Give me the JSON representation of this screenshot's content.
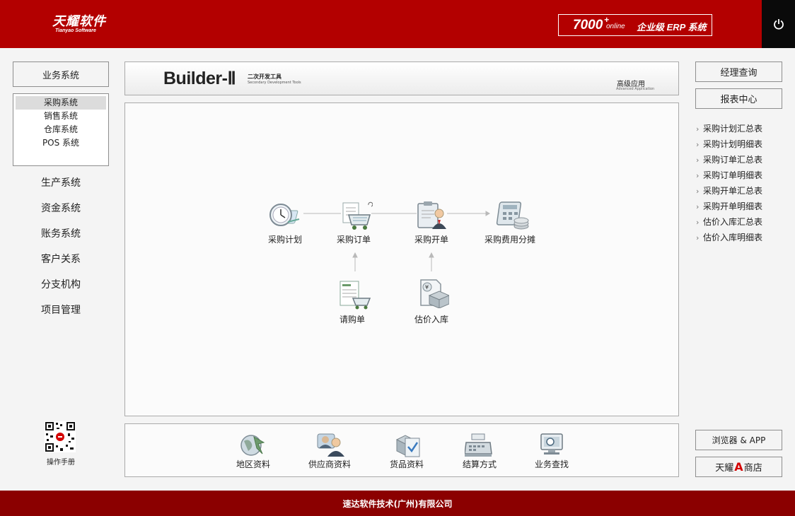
{
  "header": {
    "logo_main": "天耀软件",
    "logo_sub": "Tianyao Software",
    "product_number": "7000",
    "product_plus": "+",
    "product_online": "online",
    "product_tagline": "企业级 ERP 系统",
    "power_icon": "power-icon"
  },
  "left_nav": {
    "business_button": "业务系统",
    "sub_items": [
      "采购系统",
      "销售系统",
      "仓库系统",
      "POS 系统"
    ],
    "main_items": [
      "生产系统",
      "资金系统",
      "账务系统",
      "客户关系",
      "分支机构",
      "项目管理"
    ],
    "manual_label": "操作手册"
  },
  "builder": {
    "title": "Builder-Ⅱ",
    "subtitle_zh": "二次开发工具",
    "subtitle_en": "Secondary Development Tools",
    "advanced_zh": "高级应用",
    "advanced_en": "Advanced Application"
  },
  "flow": {
    "nodes": [
      {
        "label": "采购计划",
        "icon": "clock-document-icon"
      },
      {
        "label": "采购订单",
        "icon": "shopping-cart-icon"
      },
      {
        "label": "采购开单",
        "icon": "clipboard-person-icon"
      },
      {
        "label": "采购费用分摊",
        "icon": "calculator-coins-icon"
      },
      {
        "label": "请购单",
        "icon": "request-form-icon"
      },
      {
        "label": "估价入库",
        "icon": "yen-box-icon"
      }
    ]
  },
  "tools": [
    {
      "label": "地区资料",
      "icon": "globe-arrow-icon"
    },
    {
      "label": "供应商资料",
      "icon": "suppliers-icon"
    },
    {
      "label": "货品资料",
      "icon": "goods-checklist-icon"
    },
    {
      "label": "结算方式",
      "icon": "cash-register-icon"
    },
    {
      "label": "业务查找",
      "icon": "monitor-search-icon"
    }
  ],
  "right_panel": {
    "manager_query": "经理查询",
    "report_center": "报表中心",
    "reports": [
      "采购计划汇总表",
      "采购计划明细表",
      "采购订单汇总表",
      "采购订单明细表",
      "采购开单汇总表",
      "采购开单明细表",
      "估价入库汇总表",
      "估价入库明细表"
    ],
    "browser_app": "浏览器 & APP",
    "store_pre": "天耀",
    "store_letter": "A",
    "store_post": "商店"
  },
  "footer": {
    "company": "速达软件技术(广州)有限公司"
  },
  "colors": {
    "header_red": "#b30000",
    "footer_red": "#8b0000",
    "power_bg": "#0a0a0a",
    "store_accent": "#d40000"
  }
}
